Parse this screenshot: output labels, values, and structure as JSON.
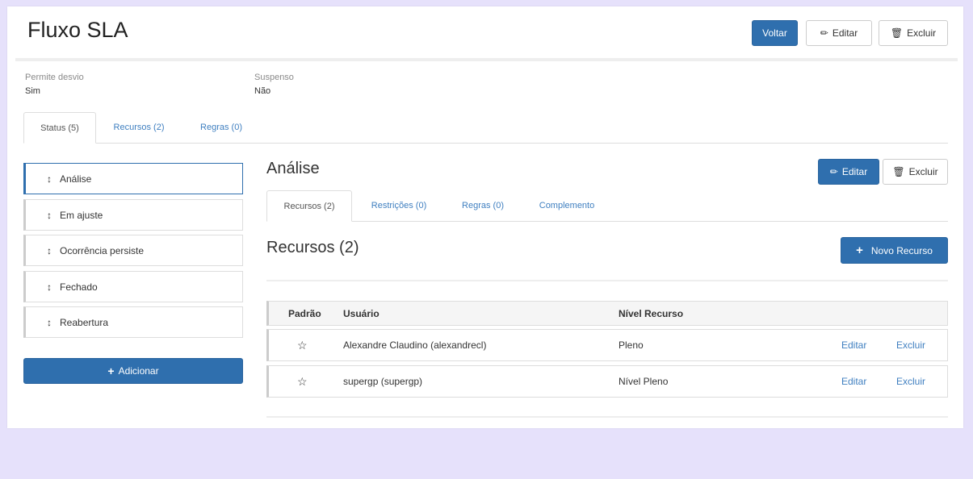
{
  "header": {
    "title": "Fluxo SLA",
    "back_label": "Voltar",
    "edit_label": "Editar",
    "delete_label": "Excluir"
  },
  "fields": [
    {
      "label": "Permite desvio",
      "value": "Sim"
    },
    {
      "label": "Suspenso",
      "value": "Não"
    }
  ],
  "main_tabs": [
    {
      "label": "Status (5)",
      "active": true
    },
    {
      "label": "Recursos (2)",
      "active": false
    },
    {
      "label": "Regras (0)",
      "active": false
    }
  ],
  "statuses": [
    {
      "label": "Análise",
      "active": true
    },
    {
      "label": "Em ajuste",
      "active": false
    },
    {
      "label": "Ocorrência persiste",
      "active": false
    },
    {
      "label": "Fechado",
      "active": false
    },
    {
      "label": "Reabertura",
      "active": false
    }
  ],
  "add_label": "Adicionar",
  "detail": {
    "title": "Análise",
    "edit_label": "Editar",
    "delete_label": "Excluir",
    "tabs": [
      {
        "label": "Recursos (2)",
        "active": true
      },
      {
        "label": "Restrições (0)",
        "active": false
      },
      {
        "label": "Regras (0)",
        "active": false
      },
      {
        "label": "Complemento",
        "active": false
      }
    ],
    "section_title": "Recursos (2)",
    "new_resource_label": "Novo Recurso",
    "table": {
      "columns": [
        "Padrão",
        "Usuário",
        "Nível Recurso"
      ],
      "rows": [
        {
          "user": "Alexandre Claudino (alexandrecl)",
          "level": "Pleno",
          "edit": "Editar",
          "delete": "Excluir"
        },
        {
          "user": "supergp (supergp)",
          "level": "Nível Pleno",
          "edit": "Editar",
          "delete": "Excluir"
        }
      ]
    }
  },
  "colors": {
    "primary": "#2f6fae",
    "link": "#3f7fc0",
    "background": "#e6e1fb"
  }
}
